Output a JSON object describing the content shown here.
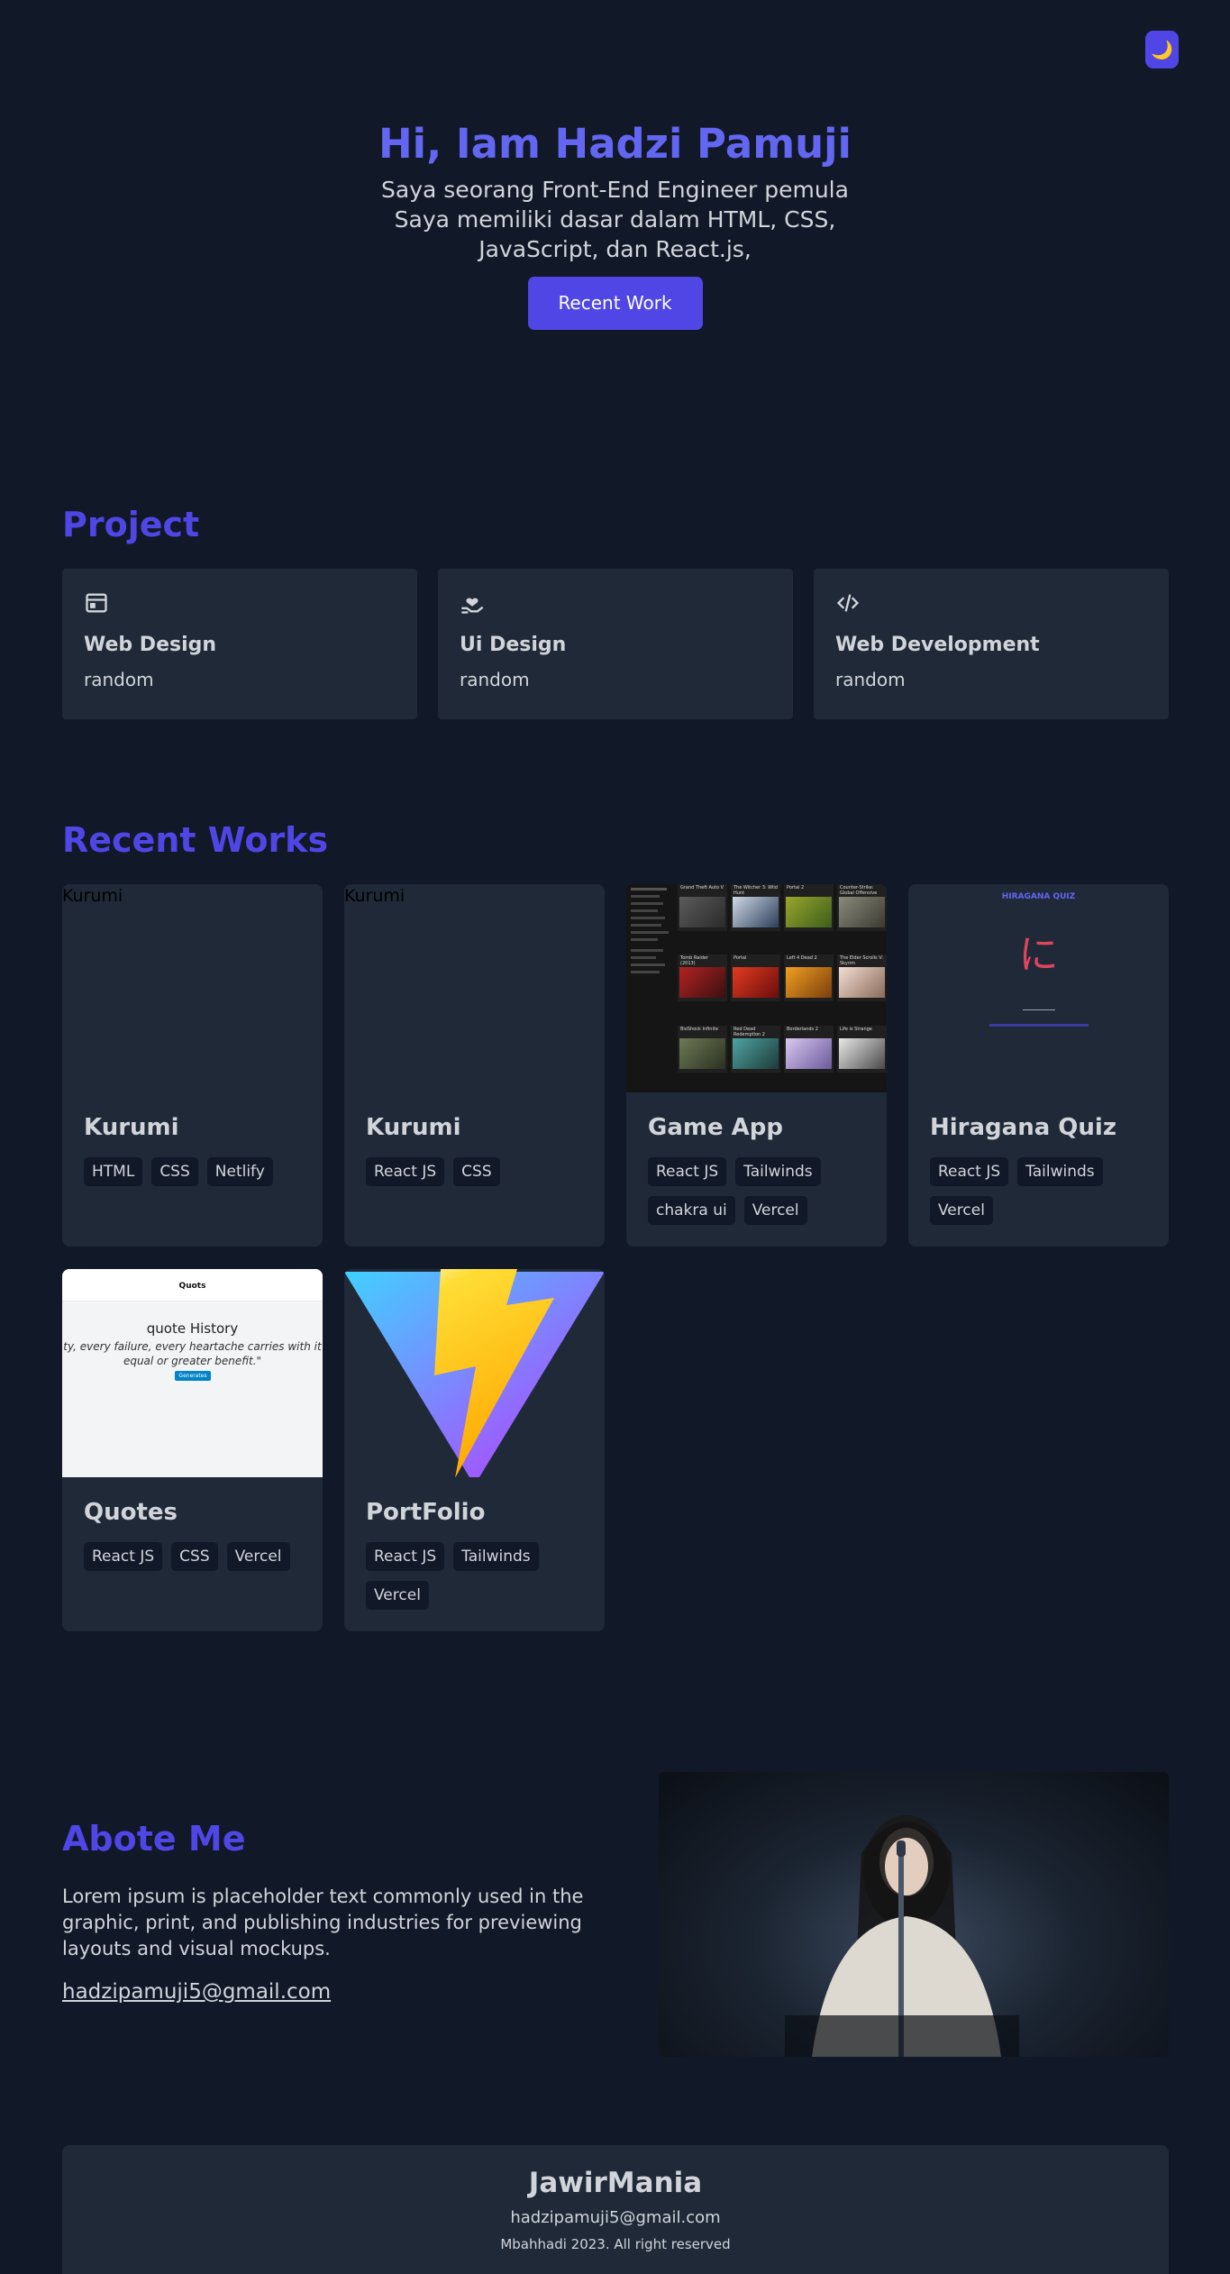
{
  "theme_toggle": {
    "icon": "moon-icon",
    "glyph": "🌙"
  },
  "hero": {
    "title": "Hi, Iam Hadzi Pamuji",
    "description": "Saya seorang Front-End Engineer pemula Saya memiliki dasar dalam HTML, CSS, JavaScript, dan React.js,",
    "button": "Recent Work"
  },
  "project": {
    "title": "Project",
    "items": [
      {
        "icon": "browser-window-icon",
        "title": "Web Design",
        "subtitle": "random"
      },
      {
        "icon": "hand-heart-icon",
        "title": "Ui Design",
        "subtitle": "random"
      },
      {
        "icon": "code-icon",
        "title": "Web Development",
        "subtitle": "random"
      }
    ]
  },
  "recent": {
    "title": "Recent Works",
    "cards": [
      {
        "alt": "Kurumi",
        "title": "Kurumi",
        "tags": [
          "HTML",
          "CSS",
          "Netlify"
        ]
      },
      {
        "alt": "Kurumi",
        "title": "Kurumi",
        "tags": [
          "React JS",
          "CSS"
        ]
      },
      {
        "title": "Game App",
        "tags": [
          "React JS",
          "Tailwinds",
          "chakra ui",
          "Vercel"
        ],
        "shot": {
          "games": [
            "Grand Theft Auto V",
            "The Witcher 3: Wild Hunt",
            "Portal 2",
            "Counter-Strike: Global Offensive",
            "Tomb Raider (2013)",
            "Portal",
            "Left 4 Dead 2",
            "The Elder Scrolls V: Skyrim",
            "BioShock Infinite",
            "Red Dead Redemption 2",
            "Borderlands 2",
            "Life is Strange"
          ]
        }
      },
      {
        "title": "Hiragana Quiz",
        "tags": [
          "React JS",
          "Tailwinds",
          "Vercel"
        ],
        "shot": {
          "heading": "HIRAGANA QUIZ",
          "char": "に"
        }
      },
      {
        "title": "Quotes",
        "tags": [
          "React JS",
          "CSS",
          "Vercel"
        ],
        "shot": {
          "app_name": "Quots",
          "history": "quote History",
          "quote": "ty, every failure, every heartache carries with it equal or greater benefit.\"",
          "button": "Generates"
        }
      },
      {
        "title": "PortFolio",
        "tags": [
          "React JS",
          "Tailwinds",
          "Vercel"
        ]
      }
    ]
  },
  "about": {
    "title": "Abote Me",
    "text": "Lorem ipsum is placeholder text commonly used in the graphic, print, and publishing industries for previewing layouts and visual mockups.",
    "email": "hadzipamuji5@gmail.com"
  },
  "footer": {
    "title": "JawirMania",
    "email": "hadzipamuji5@gmail.com",
    "copyright": "Mbahhadi 2023. All right reserved"
  }
}
